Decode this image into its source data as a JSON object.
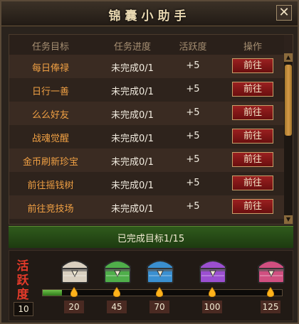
{
  "window": {
    "title": "锦囊小助手",
    "close_label": "✕"
  },
  "table": {
    "headers": [
      "任务目标",
      "任务进度",
      "活跃度",
      "操作"
    ],
    "rows": [
      {
        "name": "每日俸禄",
        "progress": "未完成0/1",
        "activity": "+5",
        "action": "前往"
      },
      {
        "name": "日行一善",
        "progress": "未完成0/1",
        "activity": "+5",
        "action": "前往"
      },
      {
        "name": "么么好友",
        "progress": "未完成0/1",
        "activity": "+5",
        "action": "前往"
      },
      {
        "name": "战魂觉醒",
        "progress": "未完成0/1",
        "activity": "+5",
        "action": "前往"
      },
      {
        "name": "金币刷新珍宝",
        "progress": "未完成0/1",
        "activity": "+5",
        "action": "前往"
      },
      {
        "name": "前往摇钱树",
        "progress": "未完成0/1",
        "activity": "+5",
        "action": "前往"
      },
      {
        "name": "前往竞技场",
        "progress": "未完成0/1",
        "activity": "+5",
        "action": "前往"
      }
    ]
  },
  "status": {
    "text": "已完成目标1/15"
  },
  "activity": {
    "label": "活跃度",
    "value": "10",
    "progress_fraction": 0.08,
    "milestones": [
      {
        "value": "20",
        "chest_color": "#d9d0c0"
      },
      {
        "value": "45",
        "chest_color": "#4fae4a"
      },
      {
        "value": "70",
        "chest_color": "#3a8fd0"
      },
      {
        "value": "100",
        "chest_color": "#9b4fd0"
      },
      {
        "value": "125",
        "chest_color": "#d04f80"
      }
    ]
  }
}
